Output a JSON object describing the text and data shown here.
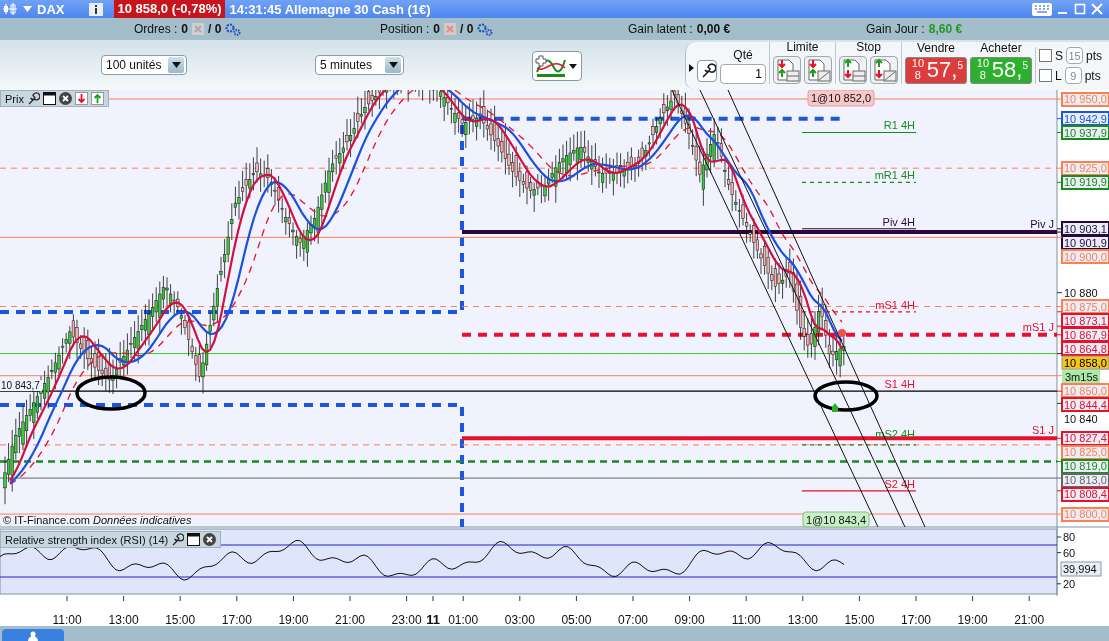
{
  "window": {
    "symbol": "DAX",
    "quote": "10 858,0 (-0,78%)",
    "title": "14:31:45 Allemagne 30 Cash (1€)"
  },
  "account_bar": {
    "orders_label": "Ordres :",
    "orders_count": "0",
    "orders_total": "/ 0",
    "position_label": "Position :",
    "position_count": "0",
    "position_total": "/ 0",
    "unrealized_label": "Gain latent :",
    "unrealized_value": "0,00 €",
    "daily_label": "Gain Jour :",
    "daily_value": "8,60 €"
  },
  "toolbar": {
    "quantity_unit": "100 unités",
    "timeframe": "5 minutes"
  },
  "order_panel": {
    "qty_label": "Qté",
    "qty": "1",
    "limit_label": "Limite",
    "stop_label": "Stop",
    "sell": {
      "label": "Vendre",
      "prefix": "10 8",
      "big": "57,",
      "small": "5"
    },
    "buy": {
      "label": "Acheter",
      "prefix": "10 8",
      "big": "58,",
      "small": "5"
    },
    "brackets": [
      {
        "letter": "S",
        "checked": false,
        "value": "15",
        "unit": "pts"
      },
      {
        "letter": "L",
        "checked": false,
        "value": "9",
        "unit": "pts"
      }
    ]
  },
  "price_panel": {
    "title": "Prix",
    "credit": "© IT-Finance.com",
    "credit_note": "Données indicatives",
    "timer": "3m15s",
    "left_label": "10 843,7",
    "orders": [
      "1@10 852,0",
      "1@10 843,4"
    ],
    "levels": [
      {
        "axis_label": "10 950,0",
        "color": "#ff7f50",
        "kind": "line"
      },
      {
        "axis_label": "10 942,9",
        "color": "#1a56e0",
        "kind": "range"
      },
      {
        "axis_label": "10 937,9",
        "color": "#1a8a1a",
        "kind": "pivot",
        "tag": {
          "text": "R1 4H",
          "color": "#1a8a1a"
        }
      },
      {
        "axis_label": "10 925,0",
        "color": "#ff7f50",
        "kind": "dashed"
      },
      {
        "axis_label": "10 919,9",
        "color": "#1a8a1a",
        "kind": "midpivot",
        "tag": {
          "text": "mR1 4H",
          "color": "#1a8a1a"
        }
      },
      {
        "axis_label": "10 903,1",
        "color": "#2a0a3a",
        "kind": "pivot",
        "tag": {
          "text": "Piv 4H",
          "color": "#2a0a3a"
        }
      },
      {
        "axis_label": "10 901,9",
        "color": "#2a0a3a",
        "kind": "daily",
        "tag": {
          "text": "Piv J",
          "color": "#2a0a3a"
        }
      },
      {
        "axis_label": "10 900,0",
        "color": "#ff7f50",
        "kind": "line"
      },
      {
        "axis_label": "10 880",
        "kind": "tick"
      },
      {
        "axis_label": "10 875,0",
        "color": "#ff7f50",
        "kind": "dashed"
      },
      {
        "axis_label": "10 873,1",
        "color": "#e8102a",
        "kind": "midpivot",
        "tag": {
          "text": "mS1 4H",
          "color": "#e8102a"
        }
      },
      {
        "axis_label": "10 867,9",
        "color": "#e8102a",
        "kind": "label"
      },
      {
        "axis_label": "10 864,8",
        "color": "#e8102a",
        "kind": "dailydash",
        "tag": {
          "text": "mS1 J",
          "color": "#e8102a"
        }
      },
      {
        "axis_label": "10 858,0",
        "kind": "current"
      },
      {
        "axis_label": "10 850,0",
        "color": "#ff7f50",
        "kind": "line"
      },
      {
        "axis_label": "10 844,4",
        "color": "#e8102a",
        "kind": "support",
        "tag": {
          "text": "S1 4H",
          "color": "#e8102a"
        }
      },
      {
        "axis_label": "10 840",
        "kind": "tick"
      },
      {
        "axis_label": "10 827,4",
        "color": "#e8102a",
        "kind": "daily",
        "tag": {
          "text": "S1 J",
          "color": "#e8102a"
        }
      },
      {
        "axis_label": "10 825,0",
        "color": "#ff7f50",
        "kind": "dashed",
        "tag": {
          "text": "mS2 4H",
          "color": "#1a8a1a"
        }
      },
      {
        "axis_label": "10 819,0",
        "color": "#1a8a1a",
        "kind": "boldDash"
      },
      {
        "axis_label": "10 813,0",
        "color": "#666666",
        "kind": "line"
      },
      {
        "axis_label": "10 808,4",
        "color": "#e8102a",
        "kind": "pivot",
        "tag": {
          "text": "S2 4H",
          "color": "#e8102a"
        }
      },
      {
        "axis_label": "10 800,0",
        "color": "#ff7f50",
        "kind": "line"
      }
    ]
  },
  "rsi_panel": {
    "title": "Relative strength index (RSI) (14)",
    "ticks": [
      "80",
      "60",
      "20"
    ],
    "reading": "39,994"
  },
  "time_axis": [
    {
      "label": "11:00",
      "kind": "time"
    },
    {
      "label": "13:00",
      "kind": "time"
    },
    {
      "label": "15:00",
      "kind": "time"
    },
    {
      "label": "17:00",
      "kind": "time"
    },
    {
      "label": "19:00",
      "kind": "time"
    },
    {
      "label": "21:00",
      "kind": "time"
    },
    {
      "label": "23:00",
      "kind": "time"
    },
    {
      "label": "11",
      "kind": "day"
    },
    {
      "label": "01:00",
      "kind": "time"
    },
    {
      "label": "03:00",
      "kind": "time"
    },
    {
      "label": "05:00",
      "kind": "time"
    },
    {
      "label": "07:00",
      "kind": "time"
    },
    {
      "label": "09:00",
      "kind": "time"
    },
    {
      "label": "11:00",
      "kind": "time"
    },
    {
      "label": "13:00",
      "kind": "time"
    },
    {
      "label": "15:00",
      "kind": "time"
    },
    {
      "label": "17:00",
      "kind": "time"
    },
    {
      "label": "19:00",
      "kind": "time"
    },
    {
      "label": "21:00",
      "kind": "time"
    }
  ]
}
